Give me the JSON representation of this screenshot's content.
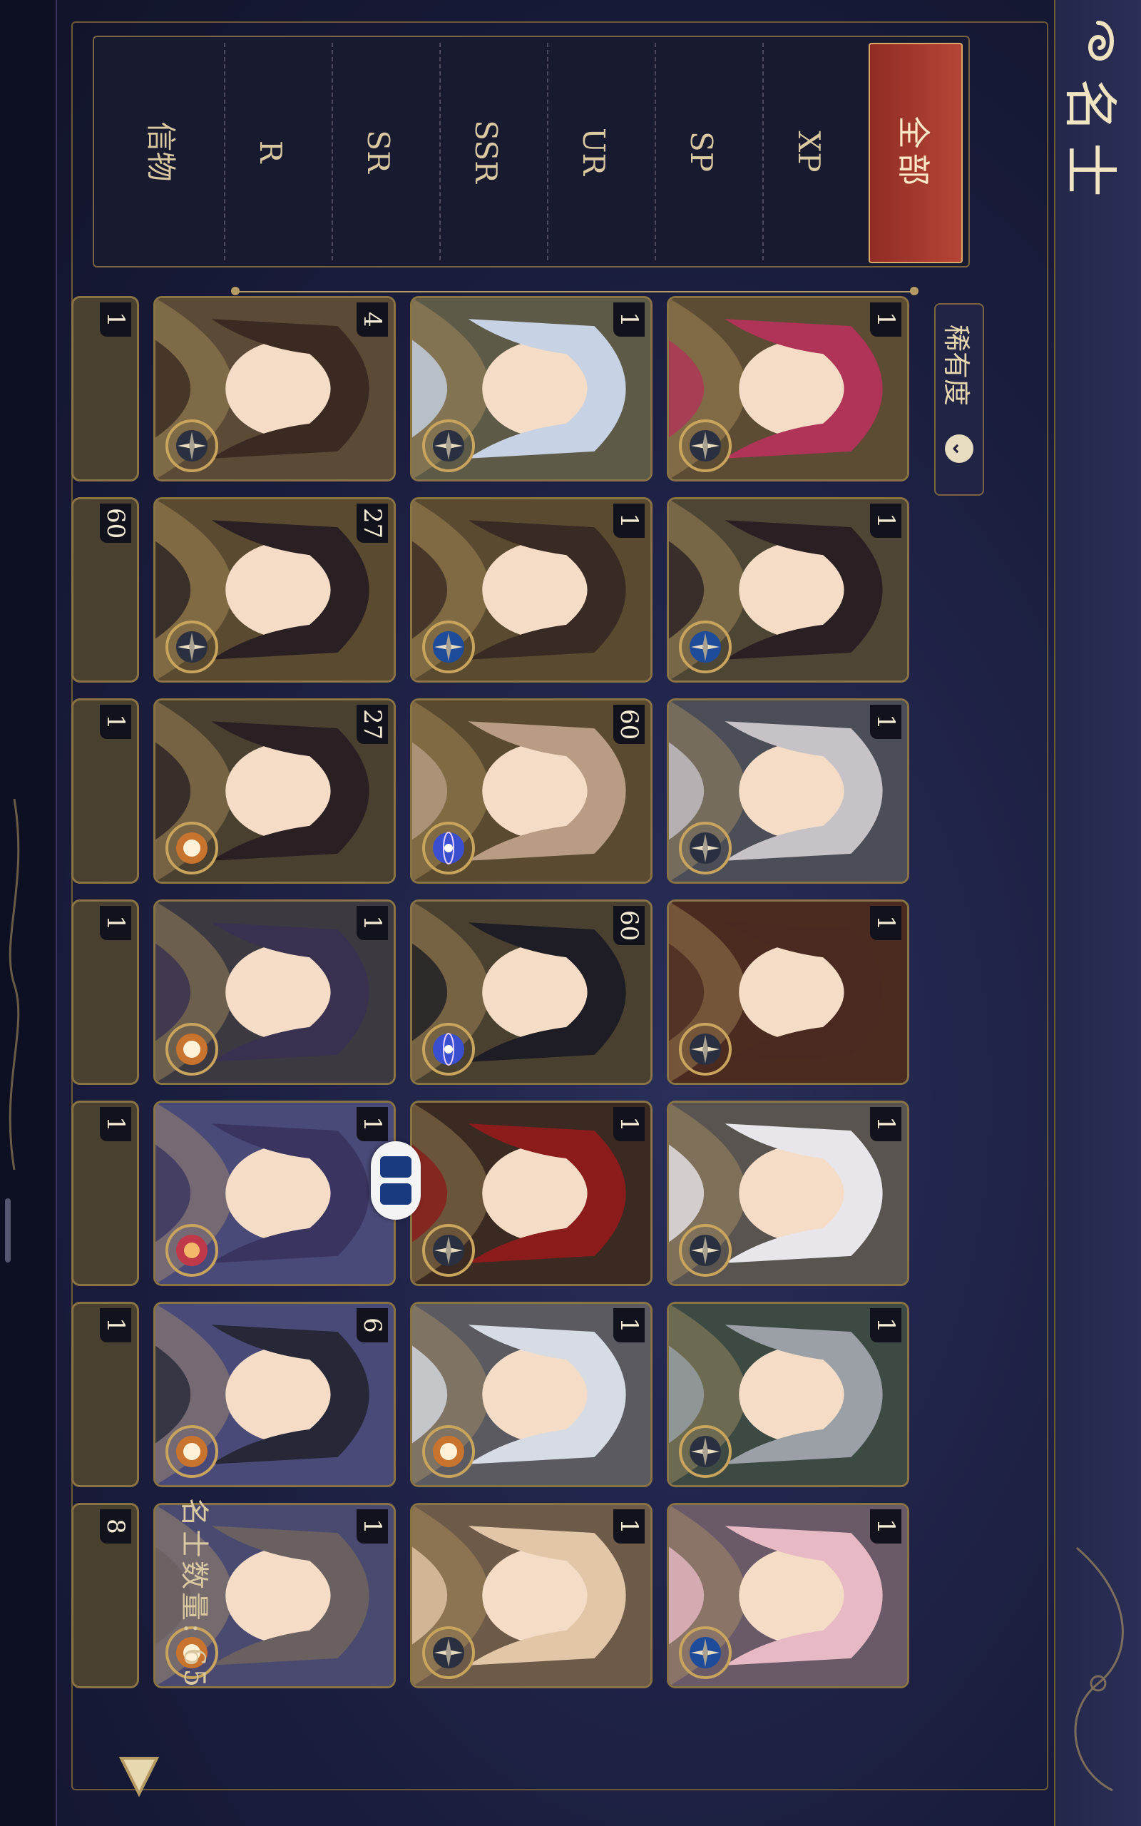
{
  "header": {
    "title": "名士"
  },
  "filters": [
    {
      "label": "全部",
      "active": true
    },
    {
      "label": "XP"
    },
    {
      "label": "SP"
    },
    {
      "label": "UR"
    },
    {
      "label": "SSR"
    },
    {
      "label": "SR"
    },
    {
      "label": "R"
    },
    {
      "label": "信物"
    }
  ],
  "sort": {
    "label": "稀有度"
  },
  "footer": {
    "count_label": "名士数量: 65"
  },
  "colors": {
    "background": "#1a1d3d",
    "gold_border": "#8a7444",
    "active_filter": "#a53a2e",
    "text": "#d9c8a0"
  },
  "cards": [
    {
      "count": "1",
      "emblem": "compass",
      "hair": "#b03358",
      "bg": "#5c4c34"
    },
    {
      "count": "1",
      "emblem": "compass-blue",
      "hair": "#2a2024",
      "bg": "#4e4634"
    },
    {
      "count": "1",
      "emblem": "compass",
      "hair": "#c7c2c8",
      "bg": "#4b4e56"
    },
    {
      "count": "1",
      "emblem": "compass",
      "hair": "#4a2a20",
      "bg": "#4b2a20"
    },
    {
      "count": "1",
      "emblem": "compass",
      "hair": "#e8e6ea",
      "bg": "#5a5450"
    },
    {
      "count": "1",
      "emblem": "compass",
      "hair": "#9aa0a6",
      "bg": "#3d4a44"
    },
    {
      "count": "1",
      "emblem": "compass-blue",
      "hair": "#e7b9c4",
      "bg": "#6a5a68"
    },
    {
      "count": "1",
      "emblem": "compass",
      "hair": "#c7d2e4",
      "bg": "#5e5a48"
    },
    {
      "count": "1",
      "emblem": "compass-blue",
      "hair": "#3a2a24",
      "bg": "#5a4a30"
    },
    {
      "count": "60",
      "emblem": "orb",
      "hair": "#b89c84",
      "bg": "#5a4a30"
    },
    {
      "count": "60",
      "emblem": "orb",
      "hair": "#1e1c24",
      "bg": "#4a4030"
    },
    {
      "count": "1",
      "emblem": "compass",
      "hair": "#8c1c1c",
      "bg": "#3a2a22"
    },
    {
      "count": "1",
      "emblem": "moon",
      "hair": "#d6dbe4",
      "bg": "#5a5a60"
    },
    {
      "count": "1",
      "emblem": "compass",
      "hair": "#e1c6a8",
      "bg": "#6e5a48"
    },
    {
      "count": "4",
      "emblem": "compass",
      "hair": "#3a2a22",
      "bg": "#5a4a36"
    },
    {
      "count": "27",
      "emblem": "compass",
      "hair": "#2a2024",
      "bg": "#5a4a30"
    },
    {
      "count": "27",
      "emblem": "moon",
      "hair": "#2a2024",
      "bg": "#4a4030"
    },
    {
      "count": "1",
      "emblem": "moon",
      "hair": "#3a3050",
      "bg": "#3c3a40"
    },
    {
      "count": "1",
      "emblem": "sun",
      "hair": "#3a3460",
      "bg": "#4a4a78"
    },
    {
      "count": "6",
      "emblem": "moon",
      "hair": "#262838",
      "bg": "#4a4a78"
    },
    {
      "count": "1",
      "emblem": "moon",
      "hair": "#6a6060",
      "bg": "#4a4a70"
    }
  ],
  "partial_cards": [
    "1",
    "60",
    "1",
    "1",
    "1",
    "1",
    "8"
  ]
}
